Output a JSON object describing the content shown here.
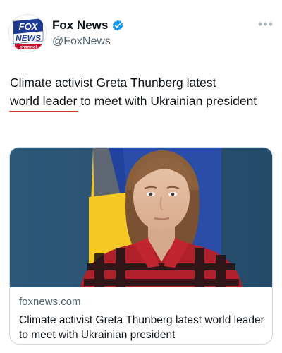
{
  "account": {
    "display_name": "Fox News",
    "handle": "@FoxNews",
    "avatar_logo": {
      "line1": "FOX",
      "line2": "NEWS",
      "line3": "channel"
    }
  },
  "menu_icon": "more-dots-icon",
  "menu_glyph": "•••",
  "tweet": {
    "text_part1": "Climate activist Greta Thunberg latest ",
    "text_highlight": "world leader",
    "text_part2": " to meet with Ukrainian president"
  },
  "link_card": {
    "domain": "foxnews.com",
    "title": "Climate activist Greta Thunberg latest world leader to meet with Ukrainian president"
  },
  "colors": {
    "verified_badge": "#1d9bf0",
    "underline": "#d6332a",
    "fox_red": "#c8102e",
    "fox_blue": "#1f3a93"
  }
}
